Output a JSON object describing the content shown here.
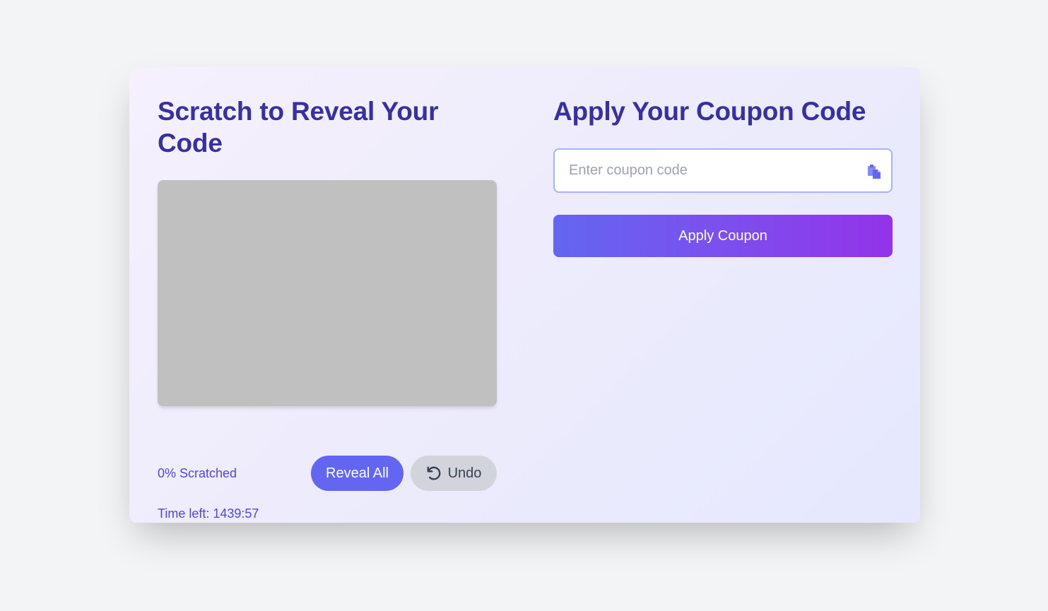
{
  "scratch": {
    "title": "Scratch to Reveal Your Code",
    "progress_text": "0% Scratched",
    "progress_percent": 0,
    "reveal_all_label": "Reveal All",
    "undo_label": "Undo",
    "undo_icon": "undo-arrow-icon",
    "timer_text": "Time left: 1439:57",
    "cover_color": "#c0c0c0"
  },
  "coupon": {
    "title": "Apply Your Coupon Code",
    "input_value": "",
    "input_placeholder": "Enter coupon code",
    "paste_icon": "clipboard-paste-icon",
    "apply_label": "Apply Coupon"
  },
  "colors": {
    "heading": "#3730a3",
    "accent": "#6366f1",
    "accent_end": "#9333ea",
    "secondary_button": "#d1d5db",
    "page_background": "#f3f4f6"
  }
}
